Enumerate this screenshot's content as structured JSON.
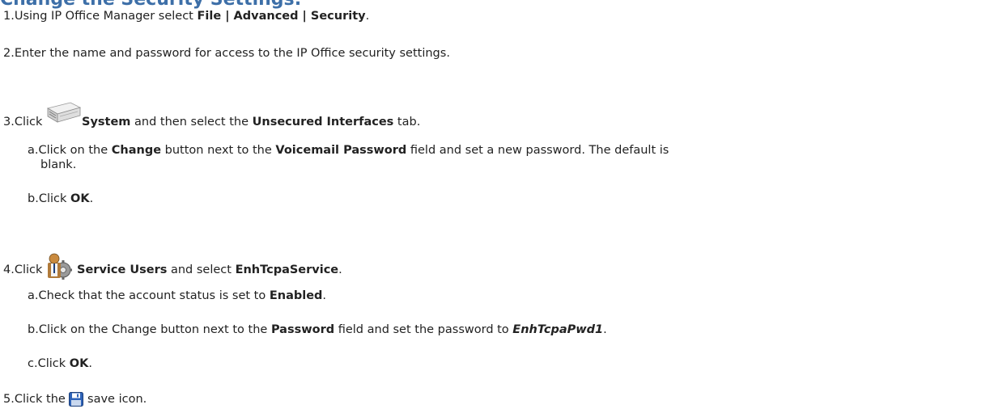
{
  "heading": "Change the Security Settings:",
  "steps": [
    {
      "num": "1.",
      "pre": "Using IP Office Manager select ",
      "bold": "File | Advanced | Security",
      "post": "."
    },
    {
      "num": "2.",
      "text": "Enter the name and password for access to the IP Office security settings."
    },
    {
      "num": "3.",
      "pre": "Click ",
      "bold1": "System",
      "mid": " and then select the ",
      "bold2": "Unsecured Interfaces",
      "post": " tab.",
      "icon": "system-unit-icon",
      "substeps": [
        {
          "num": "a.",
          "pre": "Click on the ",
          "bold1": "Change",
          "mid": " button next to the ",
          "bold2": "Voicemail Password",
          "post": " field and set a new password. The default is",
          "cont": "blank."
        },
        {
          "num": "b.",
          "pre": "Click ",
          "bold": "OK",
          "post": "."
        }
      ]
    },
    {
      "num": "4.",
      "pre": "Click ",
      "bold1": "Service Users",
      "mid": " and select ",
      "bold2": "EnhTcpaService",
      "post": ".",
      "icon": "service-users-icon",
      "substeps": [
        {
          "num": "a.",
          "pre": "Check that the account status is set to ",
          "bold": "Enabled",
          "post": "."
        },
        {
          "num": "b.",
          "pre": "Click on the Change button next to the ",
          "bold": "Password",
          "mid": " field and set the password to ",
          "bold_italic": "EnhTcpaPwd1",
          "post": "."
        },
        {
          "num": "c.",
          "pre": "Click ",
          "bold": "OK",
          "post": "."
        }
      ]
    },
    {
      "num": "5.",
      "pre": "Click the ",
      "post": " save icon.",
      "icon": "save-icon"
    }
  ],
  "colors": {
    "heading": "#3d6fa8",
    "text": "#222222"
  }
}
